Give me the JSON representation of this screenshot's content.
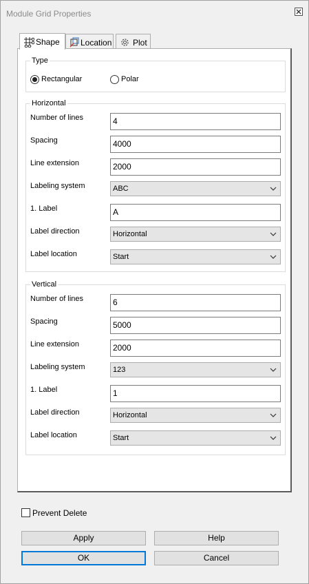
{
  "window": {
    "title": "Module Grid Properties",
    "close_icon": "close-icon"
  },
  "tabs": [
    {
      "label": "Shape",
      "icon": "grid-shape-icon",
      "active": true
    },
    {
      "label": "Location",
      "icon": "location-icon",
      "active": false
    },
    {
      "label": "Plot",
      "icon": "gear-icon",
      "active": false
    }
  ],
  "type": {
    "title": "Type",
    "options": [
      {
        "label": "Rectangular",
        "selected": true
      },
      {
        "label": "Polar",
        "selected": false
      }
    ]
  },
  "horizontal": {
    "title": "Horizontal",
    "number_of_lines": {
      "label": "Number of lines",
      "value": "4"
    },
    "spacing": {
      "label": "Spacing",
      "value": "4000"
    },
    "line_extension": {
      "label": "Line extension",
      "value": "2000"
    },
    "labeling_system": {
      "label": "Labeling system",
      "value": "ABC"
    },
    "first_label": {
      "label": "1. Label",
      "value": "A"
    },
    "label_direction": {
      "label": "Label direction",
      "value": "Horizontal"
    },
    "label_location": {
      "label": "Label location",
      "value": "Start"
    }
  },
  "vertical": {
    "title": "Vertical",
    "number_of_lines": {
      "label": "Number of lines",
      "value": "6"
    },
    "spacing": {
      "label": "Spacing",
      "value": "5000"
    },
    "line_extension": {
      "label": "Line extension",
      "value": "2000"
    },
    "labeling_system": {
      "label": "Labeling system",
      "value": "123"
    },
    "first_label": {
      "label": "1. Label",
      "value": "1"
    },
    "label_direction": {
      "label": "Label direction",
      "value": "Horizontal"
    },
    "label_location": {
      "label": "Label location",
      "value": "Start"
    }
  },
  "prevent_delete": {
    "label": "Prevent Delete",
    "checked": false
  },
  "buttons": {
    "apply": "Apply",
    "help": "Help",
    "ok": "OK",
    "cancel": "Cancel"
  },
  "colors": {
    "default_button_border": "#0078d7",
    "title_text": "#8a8a8a"
  }
}
